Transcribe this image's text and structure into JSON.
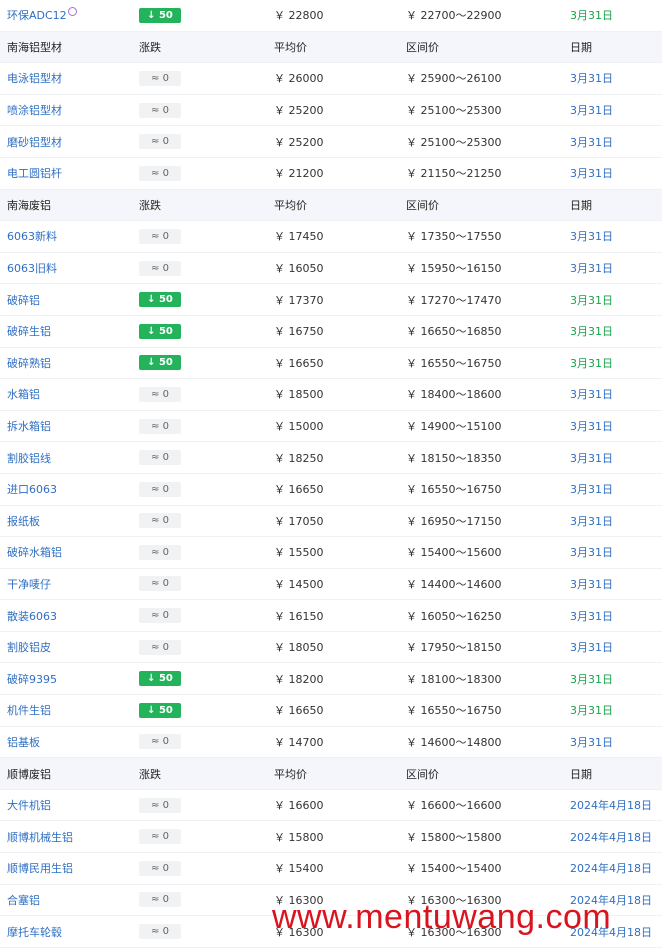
{
  "headers": {
    "change": "涨跌",
    "avg": "平均价",
    "range": "区间价",
    "date": "日期"
  },
  "watermark": "www.mentuwang.com",
  "rows": [
    {
      "type": "item",
      "name": "环保ADC12",
      "change": "↓ 50",
      "dir": "down",
      "avg": "￥ 22800",
      "range": "￥ 22700～22900",
      "date": "3月31日",
      "dateColor": "green",
      "tag": true
    },
    {
      "type": "header",
      "name": "南海铝型材"
    },
    {
      "type": "item",
      "name": "电泳铝型材",
      "change": "≈ 0",
      "dir": "flat",
      "avg": "￥ 26000",
      "range": "￥ 25900～26100",
      "date": "3月31日",
      "dateColor": "blue"
    },
    {
      "type": "item",
      "name": "喷涂铝型材",
      "change": "≈ 0",
      "dir": "flat",
      "avg": "￥ 25200",
      "range": "￥ 25100～25300",
      "date": "3月31日",
      "dateColor": "blue"
    },
    {
      "type": "item",
      "name": "磨砂铝型材",
      "change": "≈ 0",
      "dir": "flat",
      "avg": "￥ 25200",
      "range": "￥ 25100～25300",
      "date": "3月31日",
      "dateColor": "blue"
    },
    {
      "type": "item",
      "name": "电工圆铝杆",
      "change": "≈ 0",
      "dir": "flat",
      "avg": "￥ 21200",
      "range": "￥ 21150～21250",
      "date": "3月31日",
      "dateColor": "blue"
    },
    {
      "type": "header",
      "name": "南海废铝"
    },
    {
      "type": "item",
      "name": "6063新料",
      "change": "≈ 0",
      "dir": "flat",
      "avg": "￥ 17450",
      "range": "￥ 17350～17550",
      "date": "3月31日",
      "dateColor": "blue"
    },
    {
      "type": "item",
      "name": "6063旧料",
      "change": "≈ 0",
      "dir": "flat",
      "avg": "￥ 16050",
      "range": "￥ 15950～16150",
      "date": "3月31日",
      "dateColor": "blue"
    },
    {
      "type": "item",
      "name": "破碎铝",
      "change": "↓ 50",
      "dir": "down",
      "avg": "￥ 17370",
      "range": "￥ 17270～17470",
      "date": "3月31日",
      "dateColor": "green"
    },
    {
      "type": "item",
      "name": "破碎生铝",
      "change": "↓ 50",
      "dir": "down",
      "avg": "￥ 16750",
      "range": "￥ 16650～16850",
      "date": "3月31日",
      "dateColor": "green"
    },
    {
      "type": "item",
      "name": "破碎熟铝",
      "change": "↓ 50",
      "dir": "down",
      "avg": "￥ 16650",
      "range": "￥ 16550～16750",
      "date": "3月31日",
      "dateColor": "green"
    },
    {
      "type": "item",
      "name": "水箱铝",
      "change": "≈ 0",
      "dir": "flat",
      "avg": "￥ 18500",
      "range": "￥ 18400～18600",
      "date": "3月31日",
      "dateColor": "blue"
    },
    {
      "type": "item",
      "name": "拆水箱铝",
      "change": "≈ 0",
      "dir": "flat",
      "avg": "￥ 15000",
      "range": "￥ 14900～15100",
      "date": "3月31日",
      "dateColor": "blue"
    },
    {
      "type": "item",
      "name": "割胶铝线",
      "change": "≈ 0",
      "dir": "flat",
      "avg": "￥ 18250",
      "range": "￥ 18150～18350",
      "date": "3月31日",
      "dateColor": "blue"
    },
    {
      "type": "item",
      "name": "进口6063",
      "change": "≈ 0",
      "dir": "flat",
      "avg": "￥ 16650",
      "range": "￥ 16550～16750",
      "date": "3月31日",
      "dateColor": "blue"
    },
    {
      "type": "item",
      "name": "报纸板",
      "change": "≈ 0",
      "dir": "flat",
      "avg": "￥ 17050",
      "range": "￥ 16950～17150",
      "date": "3月31日",
      "dateColor": "blue"
    },
    {
      "type": "item",
      "name": "破碎水箱铝",
      "change": "≈ 0",
      "dir": "flat",
      "avg": "￥ 15500",
      "range": "￥ 15400～15600",
      "date": "3月31日",
      "dateColor": "blue"
    },
    {
      "type": "item",
      "name": "干净唛仔",
      "change": "≈ 0",
      "dir": "flat",
      "avg": "￥ 14500",
      "range": "￥ 14400～14600",
      "date": "3月31日",
      "dateColor": "blue"
    },
    {
      "type": "item",
      "name": "散装6063",
      "change": "≈ 0",
      "dir": "flat",
      "avg": "￥ 16150",
      "range": "￥ 16050～16250",
      "date": "3月31日",
      "dateColor": "blue"
    },
    {
      "type": "item",
      "name": "割胶铝皮",
      "change": "≈ 0",
      "dir": "flat",
      "avg": "￥ 18050",
      "range": "￥ 17950～18150",
      "date": "3月31日",
      "dateColor": "blue"
    },
    {
      "type": "item",
      "name": "破碎9395",
      "change": "↓ 50",
      "dir": "down",
      "avg": "￥ 18200",
      "range": "￥ 18100～18300",
      "date": "3月31日",
      "dateColor": "green"
    },
    {
      "type": "item",
      "name": "机件生铝",
      "change": "↓ 50",
      "dir": "down",
      "avg": "￥ 16650",
      "range": "￥ 16550～16750",
      "date": "3月31日",
      "dateColor": "green"
    },
    {
      "type": "item",
      "name": "铝基板",
      "change": "≈ 0",
      "dir": "flat",
      "avg": "￥ 14700",
      "range": "￥ 14600～14800",
      "date": "3月31日",
      "dateColor": "blue"
    },
    {
      "type": "header",
      "name": "顺博废铝"
    },
    {
      "type": "item",
      "name": "大件机铝",
      "change": "≈ 0",
      "dir": "flat",
      "avg": "￥ 16600",
      "range": "￥ 16600～16600",
      "date": "2024年4月18日",
      "dateColor": "blue"
    },
    {
      "type": "item",
      "name": "顺博机械生铝",
      "change": "≈ 0",
      "dir": "flat",
      "avg": "￥ 15800",
      "range": "￥ 15800～15800",
      "date": "2024年4月18日",
      "dateColor": "blue"
    },
    {
      "type": "item",
      "name": "顺博民用生铝",
      "change": "≈ 0",
      "dir": "flat",
      "avg": "￥ 15400",
      "range": "￥ 15400～15400",
      "date": "2024年4月18日",
      "dateColor": "blue"
    },
    {
      "type": "item",
      "name": "合塞铝",
      "change": "≈ 0",
      "dir": "flat",
      "avg": "￥ 16300",
      "range": "￥ 16300～16300",
      "date": "2024年4月18日",
      "dateColor": "blue"
    },
    {
      "type": "item",
      "name": "摩托车轮毂",
      "change": "≈ 0",
      "dir": "flat",
      "avg": "￥ 16300",
      "range": "￥ 16300～16300",
      "date": "2024年4月18日",
      "dateColor": "blue"
    }
  ]
}
